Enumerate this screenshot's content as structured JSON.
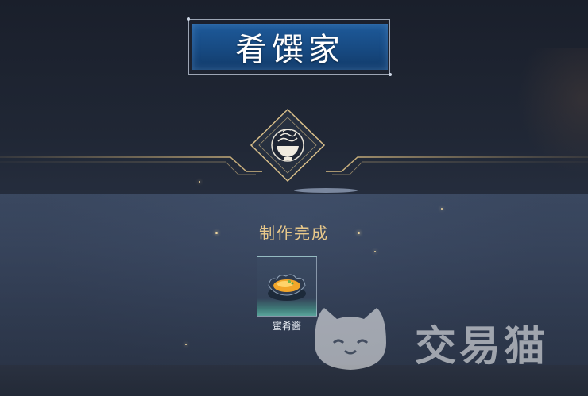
{
  "screen": {
    "title": "肴馔家",
    "emblem_icon": "bowl-steam-icon",
    "status_text": "制作完成"
  },
  "reward": {
    "item_icon": "honey-sauce-dish-icon",
    "item_name": "蜜肴酱"
  },
  "watermark": {
    "logo_icon": "cat-face-logo",
    "text": "交易猫"
  },
  "colors": {
    "title_blue": "#174a82",
    "gold": "#e9c98a",
    "panel": "#3a4862",
    "slot_teal": "#5aa39b"
  }
}
